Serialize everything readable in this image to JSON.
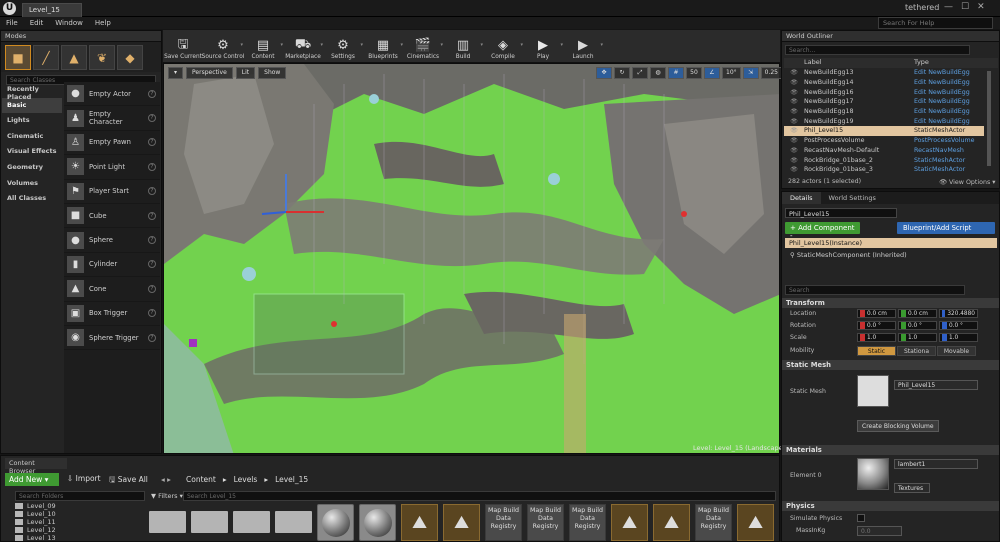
{
  "window": {
    "tab_title": "Level_15",
    "project": "tethered"
  },
  "menu": [
    "File",
    "Edit",
    "Window",
    "Help"
  ],
  "help_search": {
    "placeholder": "Search For Help"
  },
  "modes": {
    "tab": "Modes",
    "search_placeholder": "Search Classes",
    "categories": [
      "Recently Placed",
      "Basic",
      "Lights",
      "Cinematic",
      "Visual Effects",
      "Geometry",
      "Volumes",
      "All Classes"
    ],
    "active_category": "Basic",
    "items": [
      {
        "label": "Empty Actor",
        "icon": "sphere-icon"
      },
      {
        "label": "Empty Character",
        "icon": "character-icon"
      },
      {
        "label": "Empty Pawn",
        "icon": "pawn-icon"
      },
      {
        "label": "Point Light",
        "icon": "light-bulb-icon"
      },
      {
        "label": "Player Start",
        "icon": "player-start-icon"
      },
      {
        "label": "Cube",
        "icon": "cube-icon"
      },
      {
        "label": "Sphere",
        "icon": "sphere-icon"
      },
      {
        "label": "Cylinder",
        "icon": "cylinder-icon"
      },
      {
        "label": "Cone",
        "icon": "cone-icon"
      },
      {
        "label": "Box Trigger",
        "icon": "box-trigger-icon"
      },
      {
        "label": "Sphere Trigger",
        "icon": "sphere-trigger-icon"
      }
    ]
  },
  "toolbar": [
    {
      "label": "Save Current",
      "icon": "save-icon",
      "glyph": "🖫"
    },
    {
      "label": "Source Control",
      "icon": "source-control-icon",
      "glyph": "⚙"
    },
    {
      "label": "Content",
      "icon": "content-icon",
      "glyph": "▤"
    },
    {
      "label": "Marketplace",
      "icon": "marketplace-icon",
      "glyph": "⛟"
    },
    {
      "label": "Settings",
      "icon": "settings-icon",
      "glyph": "⚙"
    },
    {
      "label": "Blueprints",
      "icon": "blueprints-icon",
      "glyph": "▦"
    },
    {
      "label": "Cinematics",
      "icon": "cinematics-icon",
      "glyph": "🎬"
    },
    {
      "label": "Build",
      "icon": "build-icon",
      "glyph": "▥"
    },
    {
      "label": "Compile",
      "icon": "compile-icon",
      "glyph": "◈"
    },
    {
      "label": "Play",
      "icon": "play-icon",
      "glyph": "▶"
    },
    {
      "label": "Launch",
      "icon": "launch-icon",
      "glyph": "▶"
    }
  ],
  "viewport": {
    "view_mode": "Perspective",
    "lighting": "Lit",
    "show": "Show",
    "grid_snap": "50",
    "rot_snap": "10°",
    "scale_snap": "0.25",
    "camera_speed": "1",
    "footer": "Level: Level_15 (Landscape)"
  },
  "outliner": {
    "tab": "World Outliner",
    "search_placeholder": "Search...",
    "col_label": "Label",
    "col_type": "Type",
    "rows": [
      {
        "label": "NewBuildEgg13",
        "type": "Edit NewBuildEgg"
      },
      {
        "label": "NewBuildEgg14",
        "type": "Edit NewBuildEgg"
      },
      {
        "label": "NewBuildEgg16",
        "type": "Edit NewBuildEgg"
      },
      {
        "label": "NewBuildEgg17",
        "type": "Edit NewBuildEgg"
      },
      {
        "label": "NewBuildEgg18",
        "type": "Edit NewBuildEgg"
      },
      {
        "label": "NewBuildEgg19",
        "type": "Edit NewBuildEgg"
      },
      {
        "label": "Phil_Level15",
        "type": "StaticMeshActor",
        "selected": true
      },
      {
        "label": "PostProcessVolume",
        "type": "PostProcessVolume"
      },
      {
        "label": "RecastNavMesh-Default",
        "type": "RecastNavMesh"
      },
      {
        "label": "RockBridge_01base_2",
        "type": "StaticMeshActor"
      },
      {
        "label": "RockBridge_01base_3",
        "type": "StaticMeshActor"
      }
    ],
    "footer": "282 actors (1 selected)",
    "view_options": "View Options"
  },
  "details": {
    "tab": "Details",
    "tab2": "World Settings",
    "name": "Phil_Level15",
    "add_component": "+ Add Component -",
    "blueprint": "Blueprint/Add Script",
    "instance": "Phil_Level15(Instance)",
    "component": "StaticMeshComponent (Inherited)",
    "search_placeholder": "Search",
    "transform": {
      "title": "Transform",
      "location_label": "Location",
      "location": [
        "0.0 cm",
        "0.0 cm",
        "320.4880"
      ],
      "rotation_label": "Rotation",
      "rotation": [
        "0.0 °",
        "0.0 °",
        "0.0 °"
      ],
      "scale_label": "Scale",
      "scale": [
        "1.0",
        "1.0",
        "1.0"
      ],
      "mobility_label": "Mobility",
      "mobility": [
        "Static",
        "Stationa",
        "Movable"
      ]
    },
    "static_mesh": {
      "title": "Static Mesh",
      "label": "Static Mesh",
      "value": "Phil_Level15",
      "create_blocking": "Create Blocking Volume"
    },
    "materials": {
      "title": "Materials",
      "element_label": "Element 0",
      "value": "lambert1",
      "textures": "Textures"
    },
    "physics": {
      "title": "Physics",
      "simulate": "Simulate Physics",
      "mass_label": "MassInKg",
      "mass": "0.0"
    }
  },
  "content_browser": {
    "tab": "Content Browser",
    "add_new": "Add New",
    "import": "Import",
    "save_all": "Save All",
    "breadcrumb": [
      "Content",
      "Levels",
      "Level_15"
    ],
    "search_folders_placeholder": "Search Folders",
    "folders": [
      "Level_09",
      "Level_10",
      "Level_11",
      "Level_12",
      "Level_13"
    ],
    "filters": "Filters",
    "search_assets_placeholder": "Search Level_15",
    "assets": [
      {
        "kind": "folder"
      },
      {
        "kind": "folder"
      },
      {
        "kind": "folder"
      },
      {
        "kind": "folder"
      },
      {
        "kind": "mat"
      },
      {
        "kind": "mat"
      },
      {
        "kind": "land"
      },
      {
        "kind": "land"
      },
      {
        "kind": "reg",
        "label": "Map Build Data Registry"
      },
      {
        "kind": "reg",
        "label": "Map Build Data Registry"
      },
      {
        "kind": "reg",
        "label": "Map Build Data Registry"
      },
      {
        "kind": "land"
      },
      {
        "kind": "land"
      },
      {
        "kind": "reg",
        "label": "Map Build Data Registry"
      },
      {
        "kind": "land"
      },
      {
        "kind": "land"
      },
      {
        "kind": "reg",
        "label": "Map Build Data Registry"
      },
      {
        "kind": "land"
      }
    ]
  },
  "colors": {
    "accent": "#d09840",
    "green": "#3f9a32",
    "blue": "#2e66b1",
    "selection": "#e2c6a0",
    "landscape": "#6fd14c"
  }
}
